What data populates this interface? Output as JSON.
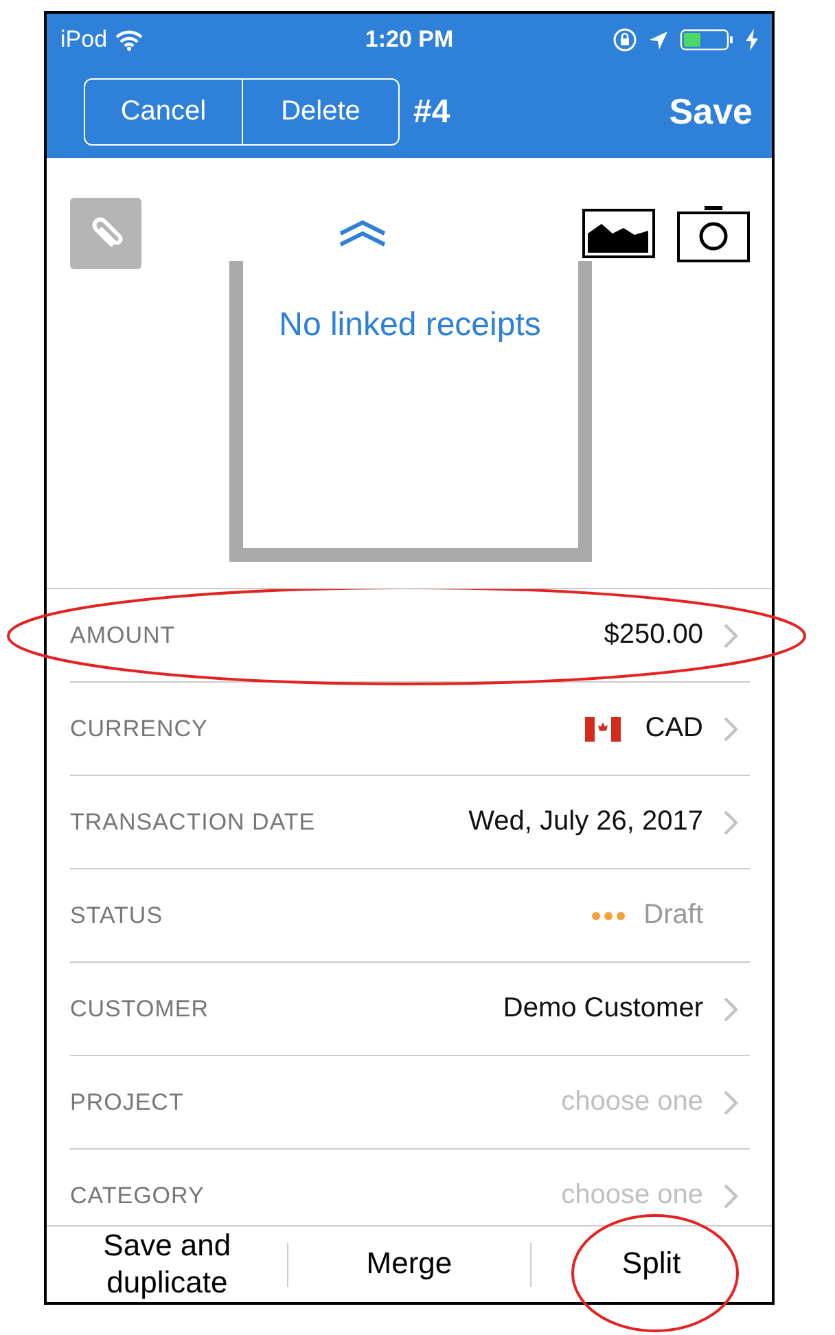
{
  "status_bar": {
    "carrier": "iPod",
    "time": "1:20 PM"
  },
  "nav": {
    "segments": [
      "Cancel",
      "Delete"
    ],
    "title": "#4",
    "action": "Save"
  },
  "receipts": {
    "empty_text": "No linked receipts"
  },
  "fields": [
    {
      "kind": "value",
      "label": "AMOUNT",
      "value": "$250.00",
      "chevron": true,
      "circled": true
    },
    {
      "kind": "currency",
      "label": "CURRENCY",
      "value": "CAD",
      "chevron": true,
      "circled": false
    },
    {
      "kind": "value",
      "label": "TRANSACTION DATE",
      "value": "Wed, July 26, 2017",
      "chevron": true,
      "circled": false
    },
    {
      "kind": "status",
      "label": "STATUS",
      "value": "Draft",
      "color": "#f5a03a",
      "chevron": false,
      "circled": false
    },
    {
      "kind": "value",
      "label": "CUSTOMER",
      "value": "Demo Customer",
      "chevron": true,
      "circled": false
    },
    {
      "kind": "choice",
      "label": "PROJECT",
      "value": "choose one",
      "chevron": true,
      "circled": false
    },
    {
      "kind": "choice",
      "label": "CATEGORY",
      "value": "choose one",
      "chevron": true,
      "circled": false
    }
  ],
  "toolbar": [
    {
      "label": "Save and duplicate",
      "circled": false
    },
    {
      "label": "Merge",
      "circled": false
    },
    {
      "label": "Split",
      "circled": true
    }
  ]
}
